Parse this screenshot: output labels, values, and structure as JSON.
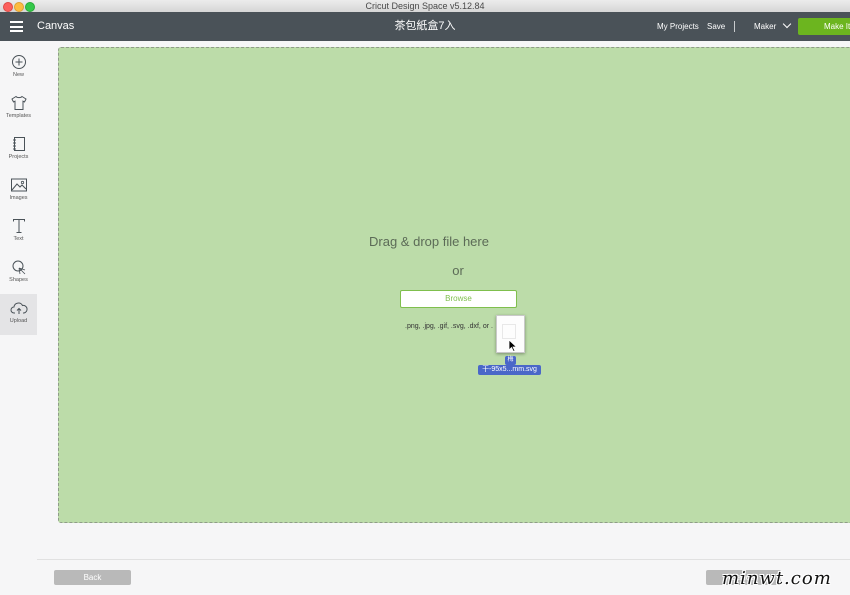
{
  "window": {
    "title": "Cricut Design Space  v5.12.84"
  },
  "header": {
    "canvas_label": "Canvas",
    "project_title": "茶包紙盒7入",
    "my_projects": "My Projects",
    "save": "Save",
    "separator": "|",
    "machine": "Maker",
    "make_it": "Make It"
  },
  "sidebar": {
    "items": [
      {
        "label": "New",
        "icon": "plus-circle-icon"
      },
      {
        "label": "Templates",
        "icon": "tshirt-icon"
      },
      {
        "label": "Projects",
        "icon": "notebook-icon"
      },
      {
        "label": "Images",
        "icon": "image-icon"
      },
      {
        "label": "Text",
        "icon": "text-icon"
      },
      {
        "label": "Shapes",
        "icon": "shapes-icon"
      },
      {
        "label": "Upload",
        "icon": "cloud-upload-icon"
      }
    ],
    "active": "Upload"
  },
  "dropzone": {
    "heading": "Drag & drop file here",
    "or": "or",
    "browse": "Browse",
    "formats": ".png, .jpg, .gif, .svg, .dxf, or .",
    "drag_badge": "梅",
    "drag_filename": "干-95x5...mm.svg"
  },
  "footer": {
    "back": "Back",
    "cancel": "Cancel"
  },
  "watermark": "minwt.com",
  "colors": {
    "header_bg": "#4a5258",
    "accent_green": "#6cb51f",
    "dropzone_bg": "#bcdca9",
    "drag_highlight": "#4a67c8"
  }
}
